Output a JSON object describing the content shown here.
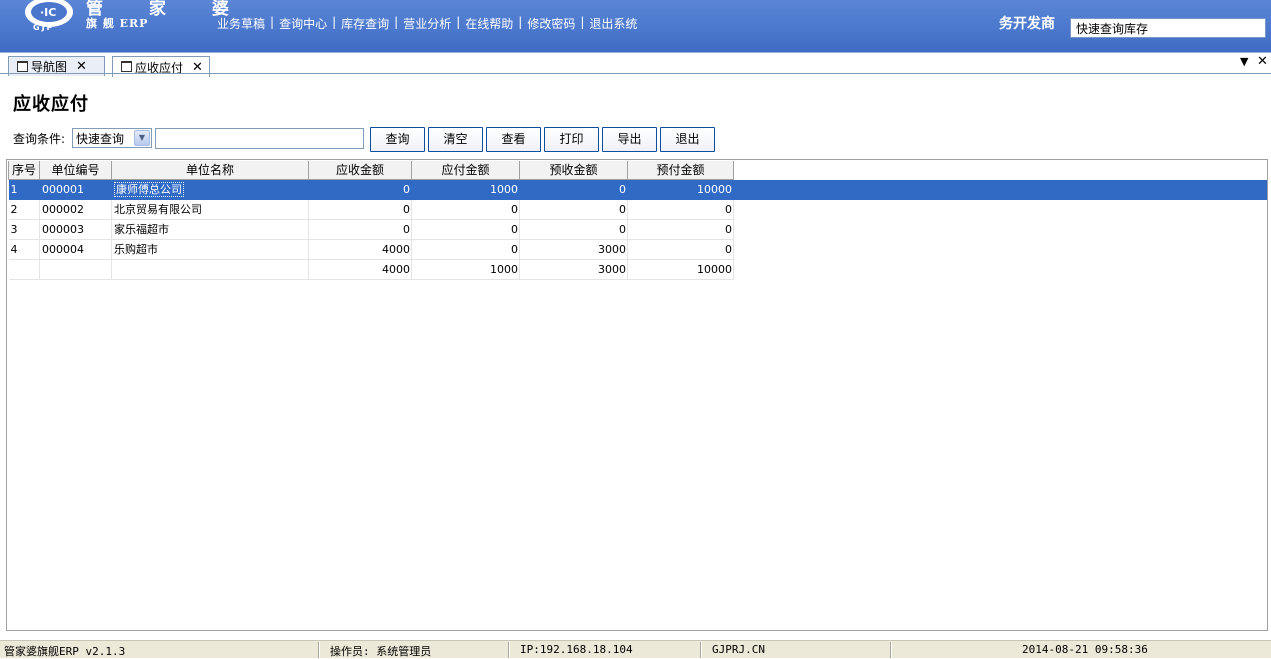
{
  "header": {
    "logo_text": "管 家 婆",
    "logo_sub": "旗 舰 ERP",
    "logo_mark": "GJP",
    "nav": [
      {
        "label": "业务草稿"
      },
      {
        "label": "查询中心"
      },
      {
        "label": "库存查询"
      },
      {
        "label": "营业分析"
      },
      {
        "label": "在线帮助"
      },
      {
        "label": "修改密码"
      },
      {
        "label": "退出系统"
      }
    ],
    "company": "务开发商",
    "quick_search_value": "快速查询库存"
  },
  "tabs": [
    {
      "label": "导航图",
      "active": false
    },
    {
      "label": "应收应付",
      "active": true
    }
  ],
  "tab_controls": {
    "dropdown": "▼",
    "close": "✕"
  },
  "page": {
    "title": "应收应付",
    "query_label": "查询条件:",
    "query_select_value": "快速查询",
    "query_input_value": "",
    "buttons": [
      {
        "label": "查询"
      },
      {
        "label": "清空"
      },
      {
        "label": "查看"
      },
      {
        "label": "打印"
      },
      {
        "label": "导出"
      },
      {
        "label": "退出"
      }
    ]
  },
  "grid": {
    "columns": [
      "序号",
      "单位编号",
      "单位名称",
      "应收金额",
      "应付金额",
      "预收金额",
      "预付金额"
    ],
    "rows": [
      [
        "1",
        "000001",
        "康师傅总公司",
        "0",
        "1000",
        "0",
        "10000"
      ],
      [
        "2",
        "000002",
        "北京贸易有限公司",
        "0",
        "0",
        "0",
        "0"
      ],
      [
        "3",
        "000003",
        "家乐福超市",
        "0",
        "0",
        "0",
        "0"
      ],
      [
        "4",
        "000004",
        "乐购超市",
        "4000",
        "0",
        "3000",
        "0"
      ]
    ],
    "totals": [
      "",
      "",
      "",
      "4000",
      "1000",
      "3000",
      "10000"
    ],
    "selected_row": 0
  },
  "statusbar": {
    "app": "管家婆旗舰ERP v2.1.3",
    "operator": "操作员: 系统管理员",
    "ip": "IP:192.168.18.104",
    "site": "GJPRJ.CN",
    "datetime": "2014-08-21 09:58:36"
  },
  "colors": {
    "header_bg": "#4a77cc",
    "selection": "#316ac5",
    "button_border": "#0e4e9e",
    "statusbar_bg": "#ece9d8"
  }
}
